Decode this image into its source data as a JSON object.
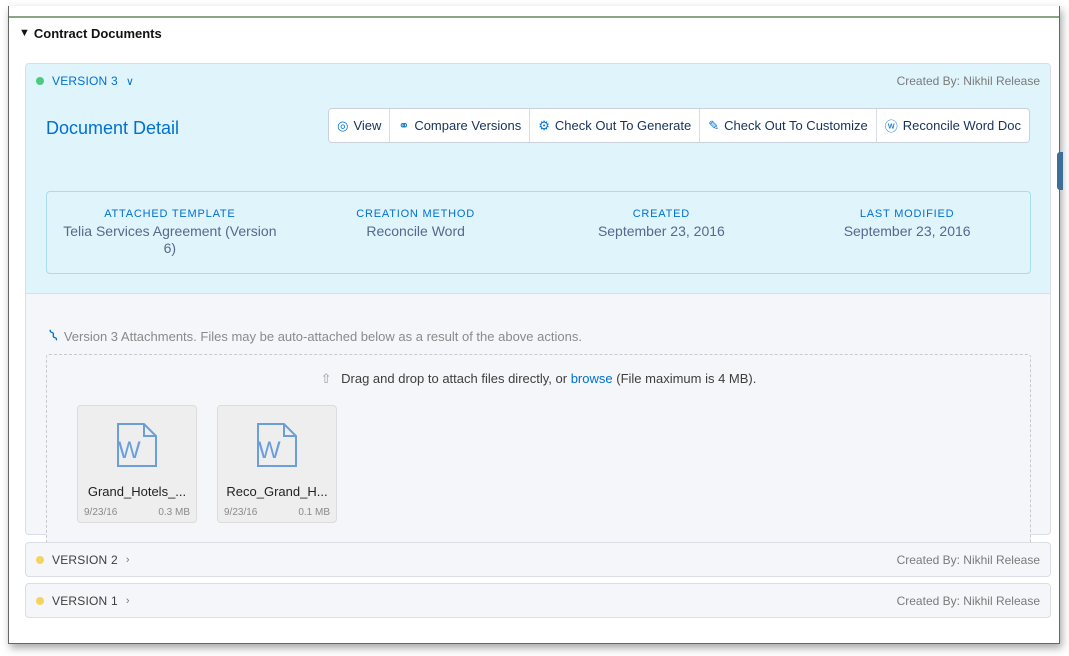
{
  "section": {
    "title": "Contract Documents"
  },
  "versions": [
    {
      "label": "VERSION 3",
      "created_by": "Created By: Nikhil Release",
      "dot_color": "#4bca81",
      "expanded": true
    },
    {
      "label": "VERSION 2",
      "created_by": "Created By: Nikhil Release",
      "dot_color": "#f4d35e",
      "expanded": false
    },
    {
      "label": "VERSION 1",
      "created_by": "Created By: Nikhil Release",
      "dot_color": "#f4d35e",
      "expanded": false
    }
  ],
  "detail": {
    "title": "Document Detail",
    "actions": [
      {
        "label": "View",
        "icon": "eye-icon"
      },
      {
        "label": "Compare Versions",
        "icon": "compare-icon"
      },
      {
        "label": "Check Out To Generate",
        "icon": "generate-icon"
      },
      {
        "label": "Check Out To Customize",
        "icon": "edit-icon"
      },
      {
        "label": "Reconcile Word Doc",
        "icon": "reconcile-icon"
      }
    ],
    "fields": [
      {
        "key": "ATTACHED TEMPLATE",
        "value": "Telia Services Agreement (Version 6)"
      },
      {
        "key": "CREATION METHOD",
        "value": "Reconcile Word"
      },
      {
        "key": "CREATED",
        "value": "September 23, 2016"
      },
      {
        "key": "LAST MODIFIED",
        "value": "September 23, 2016"
      }
    ]
  },
  "attachments": {
    "note": "Version 3 Attachments. Files may be auto-attached below as a result of the above actions.",
    "drop_text_before": "Drag and drop to attach files directly, or",
    "drop_link": "browse",
    "drop_text_after": "(File maximum is 4 MB).",
    "files": [
      {
        "name": "Grand_Hotels_...",
        "date": "9/23/16",
        "size": "0.3 MB"
      },
      {
        "name": "Reco_Grand_H...",
        "date": "9/23/16",
        "size": "0.1 MB"
      }
    ]
  },
  "colors": {
    "accent": "#0070d2",
    "panel_blue": "#e0f4fb",
    "status_green": "#4bca81",
    "status_yellow": "#f4d35e"
  }
}
